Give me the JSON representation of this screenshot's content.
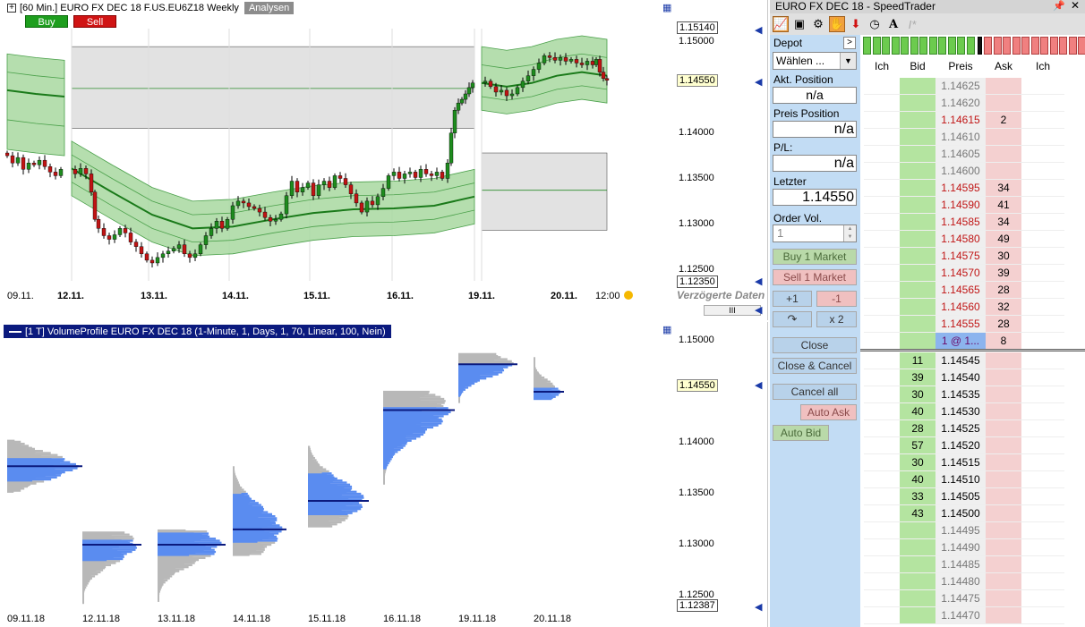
{
  "top_chart": {
    "title": "[60 Min.] EURO FX DEC 18  F.US.EU6Z18 Weekly",
    "analysen": "Analysen",
    "buy": "Buy",
    "sell": "Sell",
    "price_labels": [
      "1.15000",
      "1.14000",
      "1.13500",
      "1.13000",
      "1.12500"
    ],
    "box_top": "1.15140",
    "box_current": "1.14550",
    "box_bottom": "1.12350",
    "x_labels": [
      "09.11.",
      "12.11.",
      "13.11.",
      "14.11.",
      "15.11.",
      "16.11.",
      "19.11.",
      "20.11.",
      "12:00"
    ],
    "delayed": "Verzögerte Daten",
    "scroll_label": "III"
  },
  "bottom_chart": {
    "title": "[1 T]  VolumeProfile EURO FX DEC 18  (1-Minute, 1, Days, 1, 70, Linear, 100, Nein)",
    "price_labels": [
      "1.15000",
      "1.14000",
      "1.13500",
      "1.13000",
      "1.12500"
    ],
    "box_current": "1.14550",
    "box_bottom": "1.12387",
    "x_labels": [
      "09.11.18",
      "12.11.18",
      "13.11.18",
      "14.11.18",
      "15.11.18",
      "16.11.18",
      "19.11.18",
      "20.11.18"
    ]
  },
  "speedtrader": {
    "title": "EURO FX DEC 18  -  SpeedTrader",
    "depot_label": "Depot",
    "depot_value": "Wählen ...",
    "akt_label": "Akt. Position",
    "akt_value": "n/a",
    "preis_label": "Preis Position",
    "preis_value": "n/a",
    "pl_label": "P/L:",
    "pl_value": "n/a",
    "letzter_label": "Letzter",
    "letzter_value": "1.14550",
    "order_label": "Order Vol.",
    "order_value": "1",
    "buy_market": "Buy 1 Market",
    "sell_market": "Sell 1 Market",
    "plus1": "+1",
    "minus1": "-1",
    "x2": "x 2",
    "close": "Close",
    "close_cancel": "Close & Cancel",
    "cancel_all": "Cancel all",
    "auto_ask": "Auto Ask",
    "auto_bid": "Auto Bid",
    "headers": [
      "Ich",
      "Bid",
      "Preis",
      "Ask",
      "Ich"
    ],
    "ladder": [
      {
        "price": "1.14625",
        "bid": "",
        "ask": "",
        "side": "ask"
      },
      {
        "price": "1.14620",
        "bid": "",
        "ask": "",
        "side": "ask"
      },
      {
        "price": "1.14615",
        "bid": "",
        "ask": "2",
        "side": "ask"
      },
      {
        "price": "1.14610",
        "bid": "",
        "ask": "",
        "side": "ask"
      },
      {
        "price": "1.14605",
        "bid": "",
        "ask": "",
        "side": "ask"
      },
      {
        "price": "1.14600",
        "bid": "",
        "ask": "",
        "side": "ask"
      },
      {
        "price": "1.14595",
        "bid": "",
        "ask": "34",
        "side": "ask"
      },
      {
        "price": "1.14590",
        "bid": "",
        "ask": "41",
        "side": "ask"
      },
      {
        "price": "1.14585",
        "bid": "",
        "ask": "34",
        "side": "ask"
      },
      {
        "price": "1.14580",
        "bid": "",
        "ask": "49",
        "side": "ask"
      },
      {
        "price": "1.14575",
        "bid": "",
        "ask": "30",
        "side": "ask"
      },
      {
        "price": "1.14570",
        "bid": "",
        "ask": "39",
        "side": "ask"
      },
      {
        "price": "1.14565",
        "bid": "",
        "ask": "28",
        "side": "ask"
      },
      {
        "price": "1.14560",
        "bid": "",
        "ask": "32",
        "side": "ask"
      },
      {
        "price": "1.14555",
        "bid": "",
        "ask": "28",
        "side": "ask"
      },
      {
        "price": "1 @ 1...",
        "bid": "",
        "ask": "8",
        "side": "last"
      },
      {
        "price": "1.14545",
        "bid": "11",
        "ask": "",
        "side": "bid"
      },
      {
        "price": "1.14540",
        "bid": "39",
        "ask": "",
        "side": "bid"
      },
      {
        "price": "1.14535",
        "bid": "30",
        "ask": "",
        "side": "bid"
      },
      {
        "price": "1.14530",
        "bid": "40",
        "ask": "",
        "side": "bid"
      },
      {
        "price": "1.14525",
        "bid": "28",
        "ask": "",
        "side": "bid"
      },
      {
        "price": "1.14520",
        "bid": "57",
        "ask": "",
        "side": "bid"
      },
      {
        "price": "1.14515",
        "bid": "30",
        "ask": "",
        "side": "bid"
      },
      {
        "price": "1.14510",
        "bid": "40",
        "ask": "",
        "side": "bid"
      },
      {
        "price": "1.14505",
        "bid": "33",
        "ask": "",
        "side": "bid"
      },
      {
        "price": "1.14500",
        "bid": "43",
        "ask": "",
        "side": "bid"
      },
      {
        "price": "1.14495",
        "bid": "",
        "ask": "",
        "side": "bid"
      },
      {
        "price": "1.14490",
        "bid": "",
        "ask": "",
        "side": "bid"
      },
      {
        "price": "1.14485",
        "bid": "",
        "ask": "",
        "side": "bid"
      },
      {
        "price": "1.14480",
        "bid": "",
        "ask": "",
        "side": "bid"
      },
      {
        "price": "1.14475",
        "bid": "",
        "ask": "",
        "side": "bid"
      },
      {
        "price": "1.14470",
        "bid": "",
        "ask": "",
        "side": "bid"
      }
    ]
  },
  "colors": {
    "bull_candle": "#1e8c1e",
    "bear_candle": "#c01414",
    "band_fill": "#a8d8a0",
    "profile_blue": "#5a8cf0",
    "profile_gray": "#b8b8b8",
    "ask_bg": "#f4d0d0",
    "bid_bg": "#b4e4a0",
    "panel_bg": "#c2dcf4"
  }
}
